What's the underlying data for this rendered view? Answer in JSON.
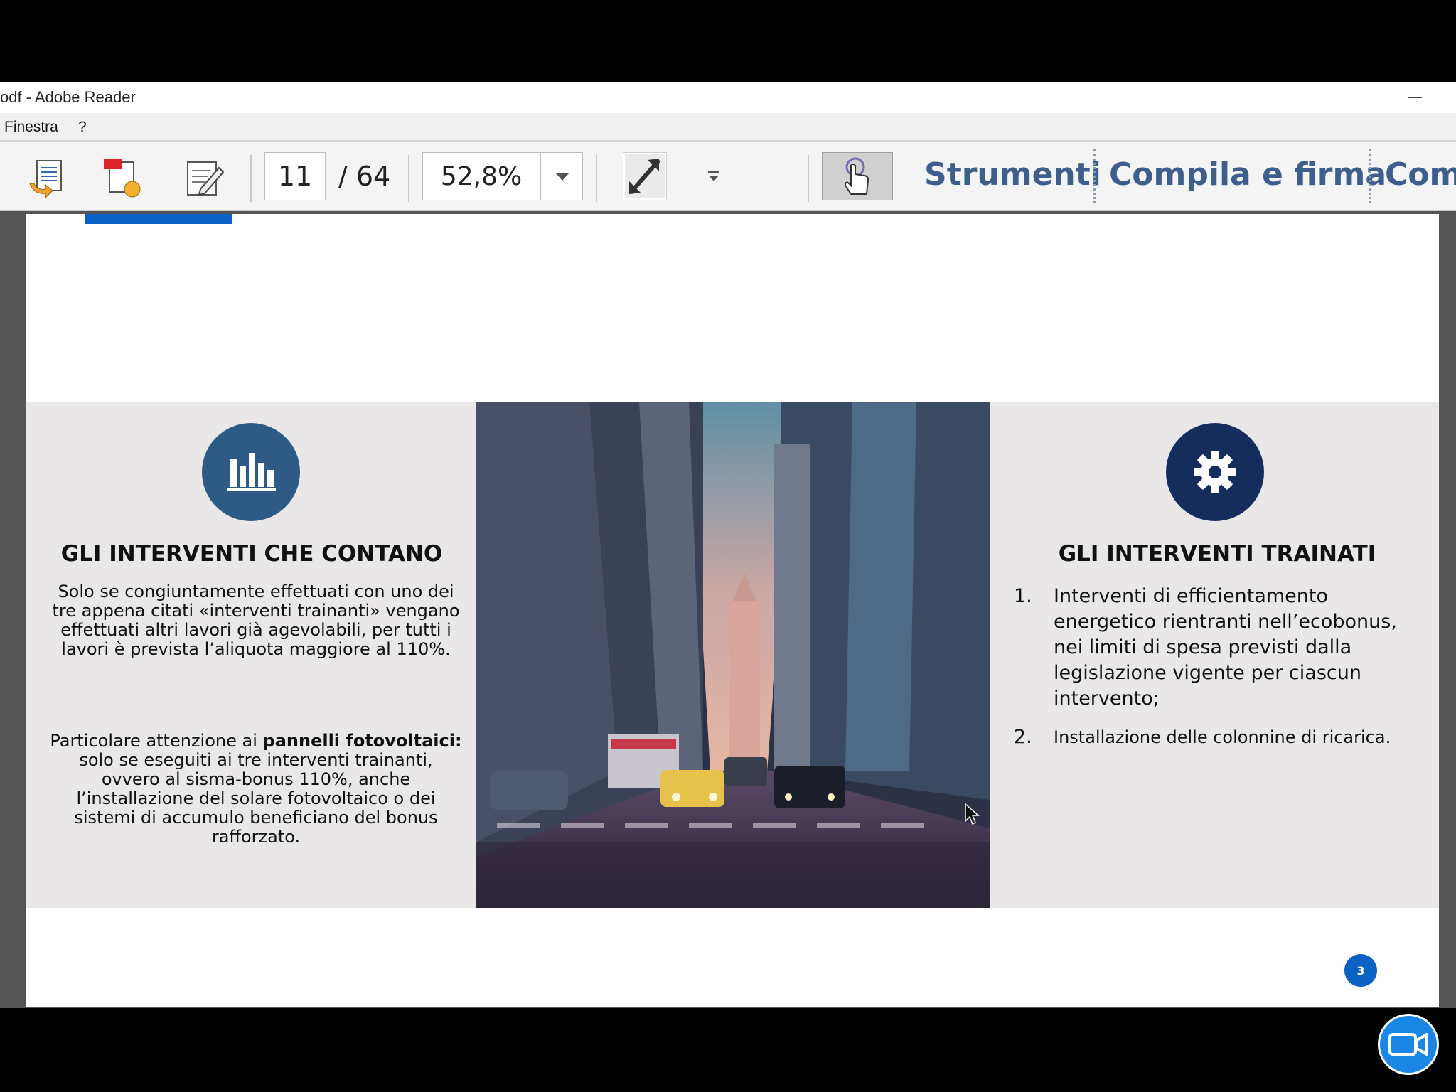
{
  "window": {
    "title": "odf - Adobe Reader"
  },
  "menu": {
    "items": [
      "Finestra",
      "?"
    ]
  },
  "toolbar": {
    "current_page": "11",
    "total_pages": "/ 64",
    "zoom": "52,8%",
    "tools_link": "Strumenti",
    "fill_sign_link": "Compila e firma",
    "comment_link": "Com"
  },
  "slide": {
    "left": {
      "icon": "bar-chart-icon",
      "heading": "GLI INTERVENTI CHE CONTANO",
      "paragraph1": "Solo se congiuntamente effettuati con uno dei tre appena citati «interventi trainanti» vengano effettuati altri lavori già agevolabili, per tutti i lavori è prevista l’aliquota maggiore al 110%.",
      "paragraph2_prefix": "Particolare attenzione ai ",
      "paragraph2_bold": "pannelli fotovoltaici:",
      "paragraph2_rest": " solo se eseguiti ai tre interventi trainanti, ovvero al sisma-bonus 110%, anche l’installazione del solare fotovoltaico o dei sistemi di accumulo beneficiano del bonus rafforzato."
    },
    "photo": {
      "subject": "city street between skyscrapers"
    },
    "right": {
      "icon": "gear-icon",
      "heading": "GLI INTERVENTI TRAINATI",
      "items": [
        {
          "num": "1.",
          "text": "Interventi di efficientamento energetico rientranti nell’ecobonus, nei limiti di spesa previsti dalla legislazione vigente per ciascun intervento;"
        },
        {
          "num": "2.",
          "text": "Installazione delle colonnine di ricarica."
        }
      ]
    },
    "page_number": "3"
  },
  "colors": {
    "accent_blue": "#0a62c6",
    "left_circle": "#2d5b86",
    "right_circle": "#142d5c",
    "panel_link": "#3e5f8d"
  }
}
